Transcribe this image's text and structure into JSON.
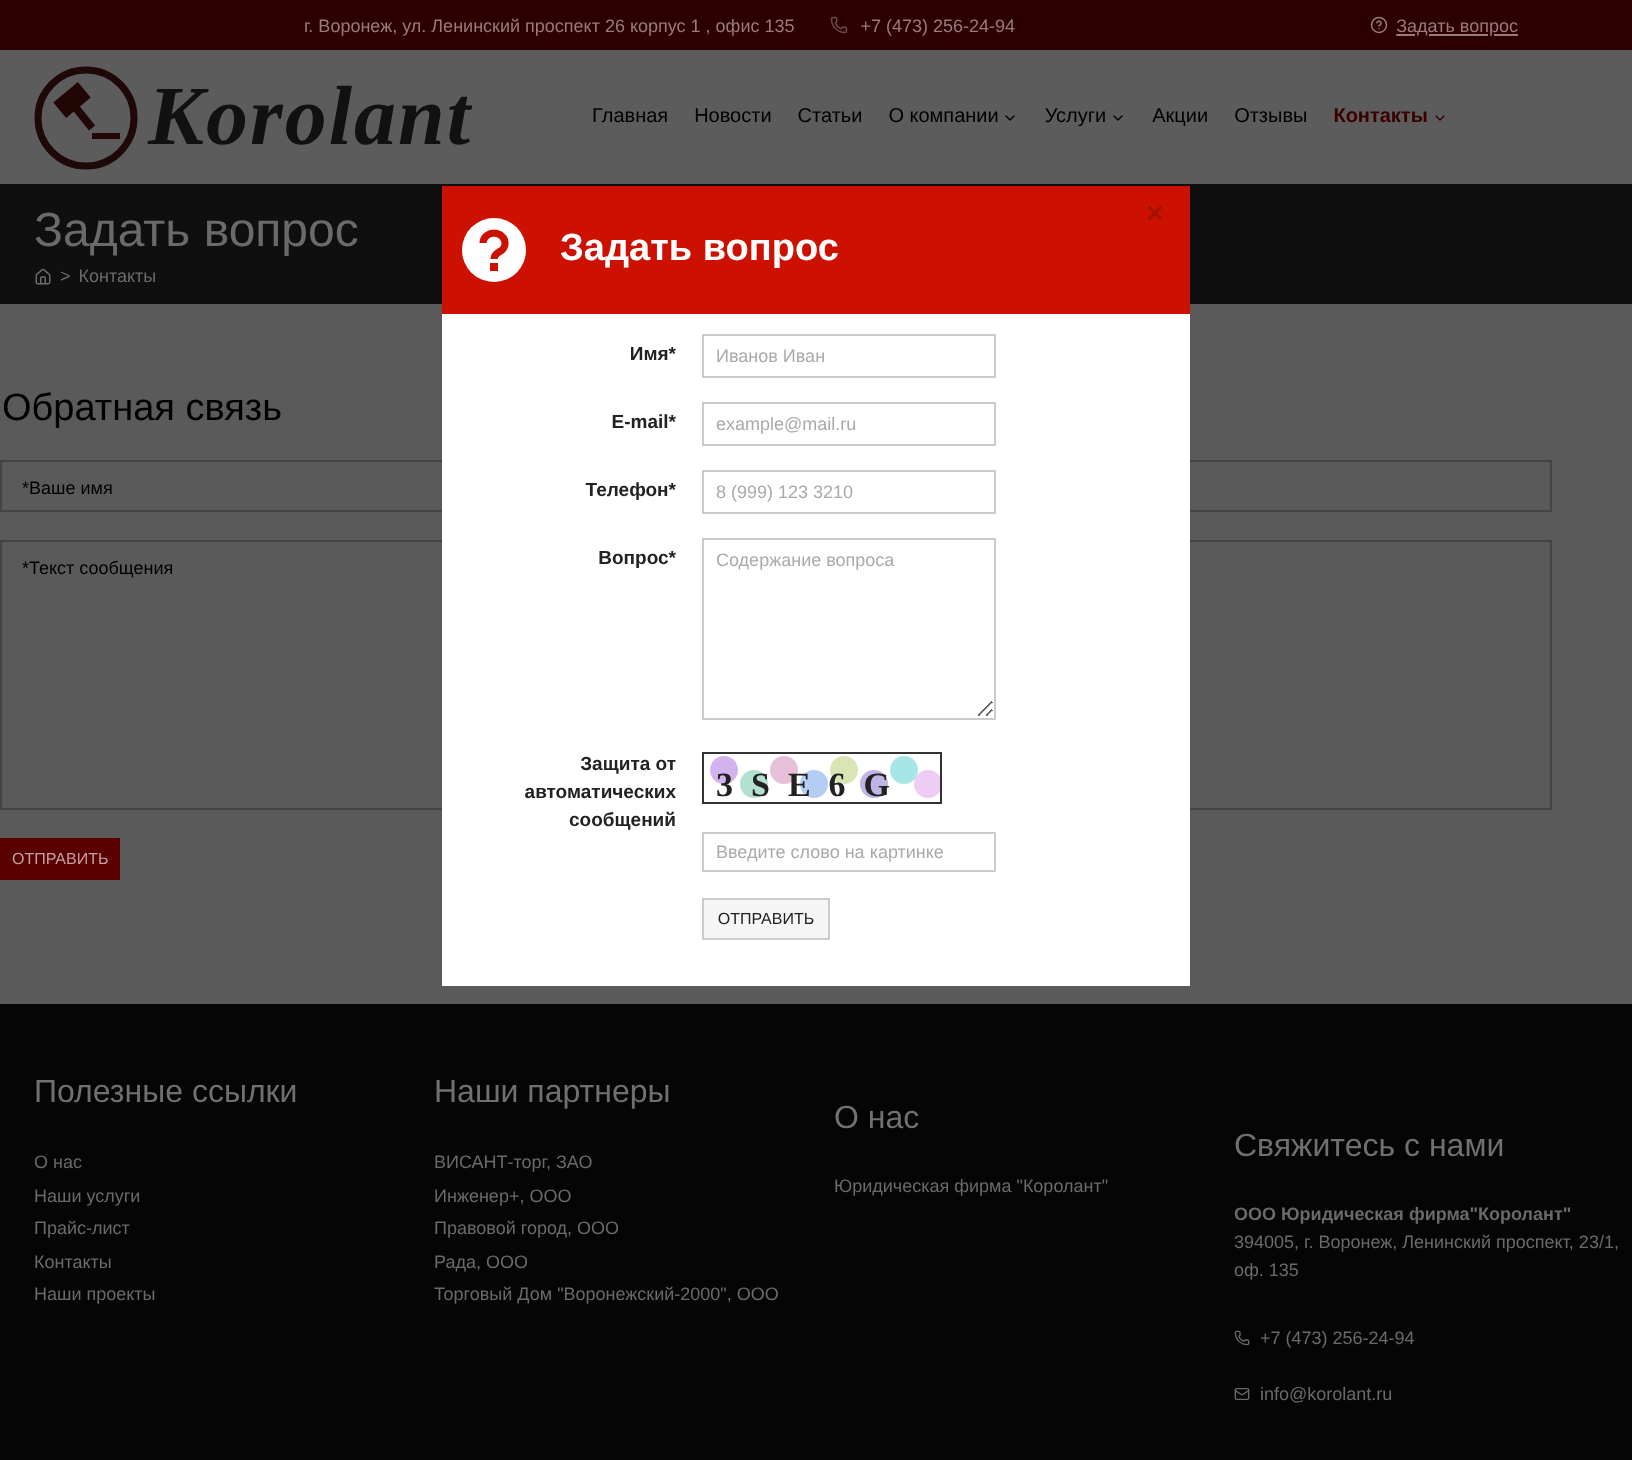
{
  "top_bar": {
    "address": "г. Воронеж, ул. Ленинский проспект 26 корпус 1 , офис 135",
    "phone": "+7 (473) 256-24-94",
    "ask_link": "Задать вопрос"
  },
  "header": {
    "logo_text": "Korolant",
    "nav": [
      {
        "label": "Главная",
        "dropdown": false,
        "selected": false
      },
      {
        "label": "Новости",
        "dropdown": false,
        "selected": false
      },
      {
        "label": "Статьи",
        "dropdown": false,
        "selected": false
      },
      {
        "label": "О компании",
        "dropdown": true,
        "selected": false
      },
      {
        "label": "Услуги",
        "dropdown": true,
        "selected": false
      },
      {
        "label": "Акции",
        "dropdown": false,
        "selected": false
      },
      {
        "label": "Отзывы",
        "dropdown": false,
        "selected": false
      },
      {
        "label": "Контакты",
        "dropdown": true,
        "selected": true
      }
    ]
  },
  "page_title": {
    "title": "Задать вопрос",
    "separator": ">",
    "breadcrumb": "Контакты"
  },
  "feedback": {
    "title": "Обратная связь",
    "name_placeholder": "*Ваше имя",
    "message_placeholder": "*Текст сообщения",
    "submit": "ОТПРАВИТЬ"
  },
  "footer": {
    "columns": [
      {
        "kind": "links",
        "title": "Полезные ссылки",
        "items": [
          "О нас",
          "Наши услуги",
          "Прайс-лист",
          "Контакты",
          "Наши проекты"
        ]
      },
      {
        "kind": "links",
        "title": "Наши партнеры",
        "items": [
          "ВИСАНТ-торг, ЗАО",
          "Инженер+, ООО",
          "Правовой город, ООО",
          "Рада, ООО",
          "Торговый Дом \"Воронежский-2000\", ООО"
        ]
      },
      {
        "kind": "about",
        "title": "О нас",
        "text": "Юридическая фирма \"Королант\""
      },
      {
        "kind": "contact",
        "title": "Свяжитесь с нами",
        "company": "ООО Юридическая фирма\"Королант\"",
        "address": "394005, г. Воронеж, Ленинский проспект, 23/1, оф. 135",
        "phone": "+7 (473) 256-24-94",
        "email": "info@korolant.ru"
      }
    ]
  },
  "modal": {
    "title": "Задать вопрос",
    "fields": [
      {
        "kind": "input",
        "label": "Имя*",
        "placeholder": "Иванов Иван"
      },
      {
        "kind": "input",
        "label": "E-mail*",
        "placeholder": "example@mail.ru"
      },
      {
        "kind": "input",
        "label": "Телефон*",
        "placeholder": "8 (999) 123 3210"
      },
      {
        "kind": "textarea",
        "label": "Вопрос*",
        "placeholder": "Содержание вопроса"
      },
      {
        "kind": "captcha",
        "label": "Защита от автоматических сообщений",
        "captcha_text": "3SE6G",
        "placeholder": "Введите слово на картинке"
      }
    ],
    "submit": "ОТПРАВИТЬ"
  }
}
